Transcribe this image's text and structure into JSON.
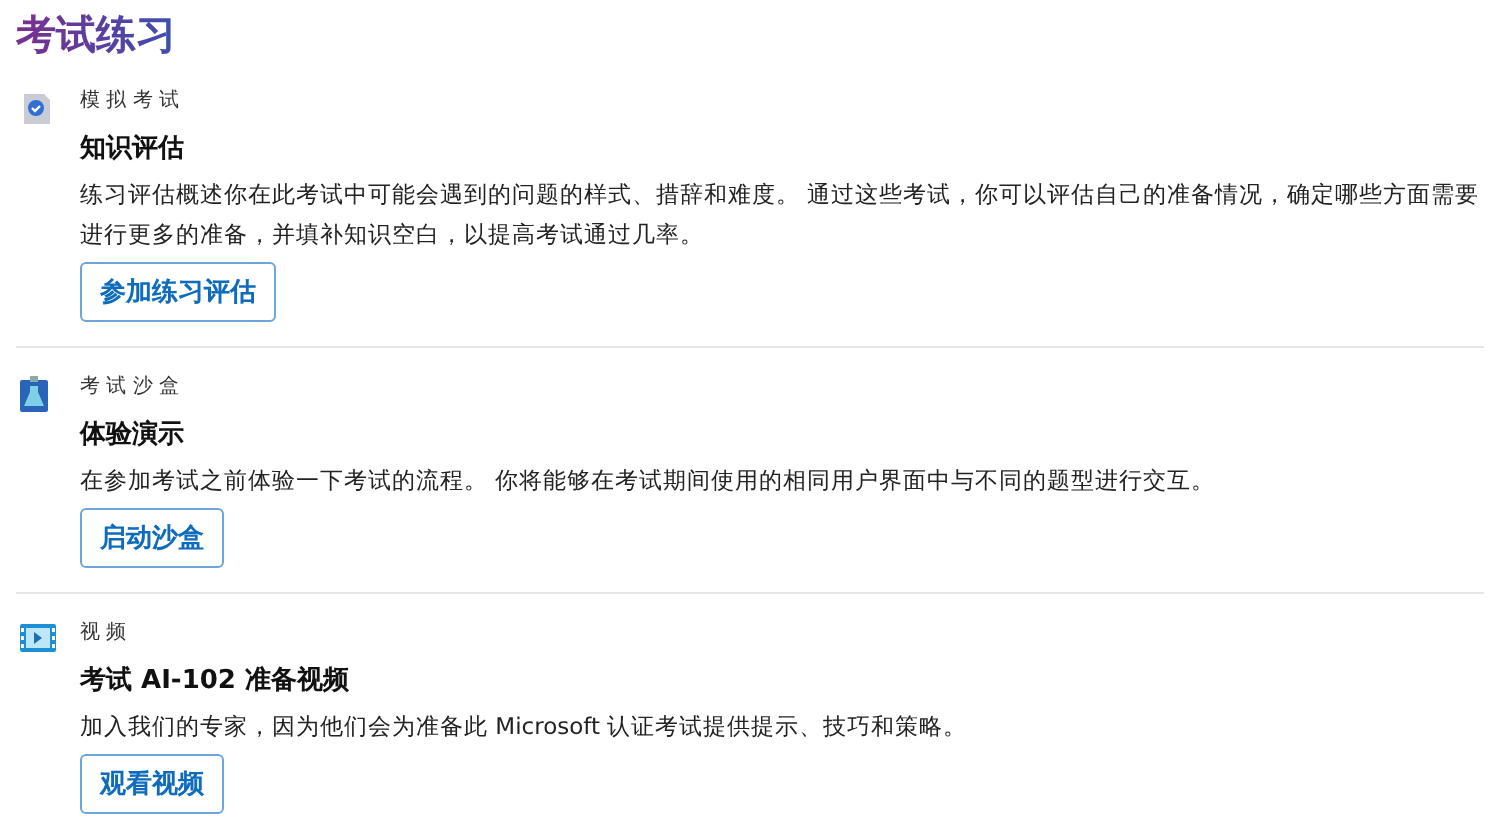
{
  "title": "考试练习",
  "sections": [
    {
      "kind": "assessment",
      "eyebrow": "模 拟 考 试",
      "heading": "知识评估",
      "description": "练习评估概述你在此考试中可能会遇到的问题的样式、措辞和难度。 通过这些考试，你可以评估自己的准备情况，确定哪些方面需要进行更多的准备，并填补知识空白，以提高考试通过几率。",
      "button": "参加练习评估"
    },
    {
      "kind": "sandbox",
      "eyebrow": "考 试 沙 盒",
      "heading": "体验演示",
      "description": "在参加考试之前体验一下考试的流程。 你将能够在考试期间使用的相同用户界面中与不同的题型进行交互。",
      "button": "启动沙盒"
    },
    {
      "kind": "video",
      "eyebrow": "视 频",
      "heading": "考试 AI-102 准备视频",
      "description": "加入我们的专家，因为他们会为准备此 Microsoft 认证考试提供提示、技巧和策略。",
      "button": "观看视频"
    }
  ]
}
